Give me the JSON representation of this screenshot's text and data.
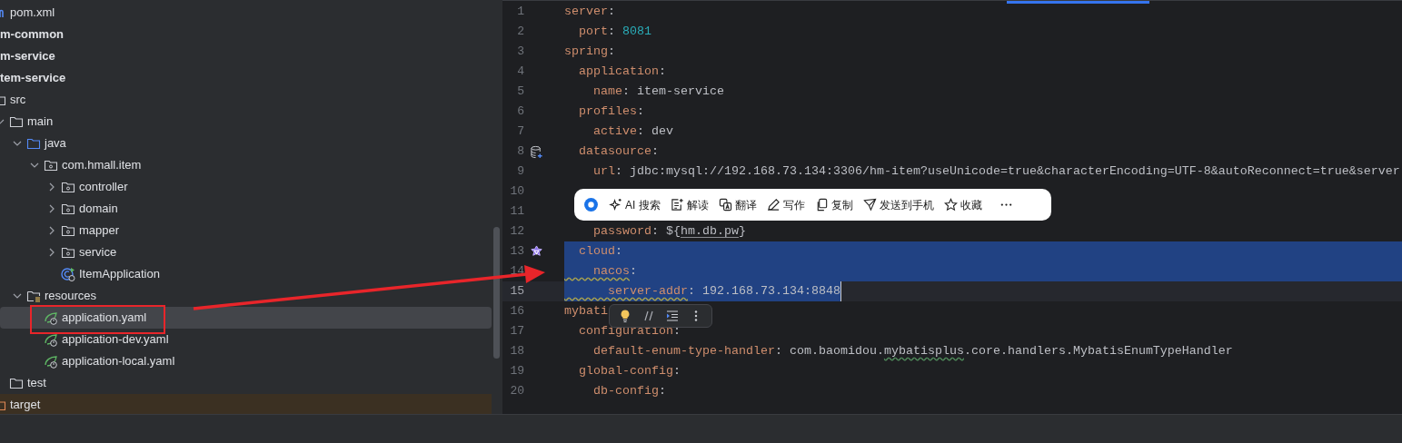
{
  "project_tree": [
    {
      "label": "pom.xml",
      "kind": "maven",
      "selected": false
    },
    {
      "label": "m-common",
      "kind": "module",
      "selected": false
    },
    {
      "label": "m-service",
      "kind": "module",
      "selected": false
    },
    {
      "label": "tem-service",
      "kind": "module",
      "selected": false,
      "children": [
        {
          "label": "src",
          "kind": "folder",
          "selected": false,
          "children": [
            {
              "label": "main",
              "kind": "folder",
              "expanded": true,
              "selected": false,
              "children": [
                {
                  "label": "java",
                  "kind": "source-folder",
                  "expanded": true,
                  "selected": false,
                  "children": [
                    {
                      "label": "com.hmall.item",
                      "kind": "package",
                      "expanded": true,
                      "selected": false,
                      "children": [
                        {
                          "label": "controller",
                          "kind": "package",
                          "expanded": false,
                          "selected": false
                        },
                        {
                          "label": "domain",
                          "kind": "package",
                          "expanded": false,
                          "selected": false
                        },
                        {
                          "label": "mapper",
                          "kind": "package",
                          "expanded": false,
                          "selected": false
                        },
                        {
                          "label": "service",
                          "kind": "package",
                          "expanded": false,
                          "selected": false
                        },
                        {
                          "label": "ItemApplication",
                          "kind": "spring-class",
                          "selected": false
                        }
                      ]
                    }
                  ]
                },
                {
                  "label": "resources",
                  "kind": "resource-folder",
                  "expanded": true,
                  "selected": false,
                  "children": [
                    {
                      "label": "application.yaml",
                      "kind": "spring-config",
                      "selected": true
                    },
                    {
                      "label": "application-dev.yaml",
                      "kind": "spring-config",
                      "selected": false
                    },
                    {
                      "label": "application-local.yaml",
                      "kind": "spring-config",
                      "selected": false
                    }
                  ]
                }
              ]
            },
            {
              "label": "test",
              "kind": "folder",
              "selected": false
            }
          ]
        },
        {
          "label": "target",
          "kind": "excluded-folder",
          "selected": false
        }
      ]
    }
  ],
  "editor": {
    "lines": [
      {
        "number": "1",
        "selected": false,
        "current": false,
        "tokens": [
          {
            "kind": "key",
            "text": "server"
          },
          {
            "kind": "text",
            "text": ":"
          }
        ]
      },
      {
        "number": "2",
        "selected": false,
        "current": false,
        "tokens": [
          {
            "kind": "key",
            "text": "  port"
          },
          {
            "kind": "text",
            "text": ": "
          },
          {
            "kind": "number",
            "text": "8081"
          }
        ]
      },
      {
        "number": "3",
        "selected": false,
        "current": false,
        "tokens": [
          {
            "kind": "key",
            "text": "spring"
          },
          {
            "kind": "text",
            "text": ":"
          }
        ]
      },
      {
        "number": "4",
        "selected": false,
        "current": false,
        "tokens": [
          {
            "kind": "key",
            "text": "  application"
          },
          {
            "kind": "text",
            "text": ":"
          }
        ]
      },
      {
        "number": "5",
        "selected": false,
        "current": false,
        "tokens": [
          {
            "kind": "key",
            "text": "    name"
          },
          {
            "kind": "text",
            "text": ": item-service"
          }
        ]
      },
      {
        "number": "6",
        "selected": false,
        "current": false,
        "tokens": [
          {
            "kind": "key",
            "text": "  profiles"
          },
          {
            "kind": "text",
            "text": ":"
          }
        ]
      },
      {
        "number": "7",
        "selected": false,
        "current": false,
        "tokens": [
          {
            "kind": "key",
            "text": "    active"
          },
          {
            "kind": "text",
            "text": ": dev"
          }
        ]
      },
      {
        "number": "8",
        "selected": false,
        "current": false,
        "kind": "database-marker",
        "tokens": [
          {
            "kind": "key",
            "text": "  datasource"
          },
          {
            "kind": "text",
            "text": ":"
          }
        ]
      },
      {
        "number": "9",
        "selected": false,
        "current": false,
        "tokens": [
          {
            "kind": "key",
            "text": "    url"
          },
          {
            "kind": "text",
            "text": ": jdbc:mysql://192.168.73.134:3306/hm-item?useUnicode=true&characterEncoding=UTF-8&autoReconnect=true&server"
          }
        ]
      },
      {
        "number": "10",
        "selected": false,
        "current": false
      },
      {
        "number": "11",
        "selected": false,
        "current": false
      },
      {
        "number": "12",
        "selected": false,
        "current": false,
        "tokens": [
          {
            "kind": "key",
            "text": "    password"
          },
          {
            "kind": "text",
            "text": ": ${"
          },
          {
            "kind": "ref",
            "text": "hm.db.pw"
          },
          {
            "kind": "text",
            "text": "}"
          }
        ]
      },
      {
        "number": "13",
        "selected": true,
        "current": false,
        "kind": "plugin-marker",
        "tokens": [
          {
            "kind": "key",
            "text": "  cloud"
          },
          {
            "kind": "text",
            "text": ":"
          }
        ]
      },
      {
        "number": "14",
        "selected": true,
        "current": false,
        "tokens": [
          {
            "kind": "key-typo",
            "text": "    nacos"
          },
          {
            "kind": "text",
            "text": ":"
          }
        ]
      },
      {
        "number": "15",
        "selected": true,
        "current": true,
        "tokens": [
          {
            "kind": "key-typo",
            "text": "      server-addr"
          },
          {
            "kind": "text",
            "text": ": 192.168.73.134:8848"
          }
        ]
      },
      {
        "number": "16",
        "selected": false,
        "current": false,
        "tokens": [
          {
            "kind": "key",
            "text": "mybati"
          }
        ]
      },
      {
        "number": "17",
        "selected": false,
        "current": false,
        "tokens": [
          {
            "kind": "key",
            "text": "  configuration"
          },
          {
            "kind": "text",
            "text": ":"
          }
        ]
      },
      {
        "number": "18",
        "selected": false,
        "current": false,
        "tokens": [
          {
            "kind": "key",
            "text": "    default-enum-type-handler"
          },
          {
            "kind": "text",
            "text": ": com.baomidou."
          },
          {
            "kind": "text-typo",
            "text": "mybatisplus"
          },
          {
            "kind": "text",
            "text": ".core.handlers.MybatisEnumTypeHandler"
          }
        ]
      },
      {
        "number": "19",
        "selected": false,
        "current": false,
        "tokens": [
          {
            "kind": "key",
            "text": "  global-config"
          },
          {
            "kind": "text",
            "text": ":"
          }
        ]
      },
      {
        "number": "20",
        "selected": false,
        "current": false,
        "tokens": [
          {
            "kind": "key",
            "text": "    db-config"
          },
          {
            "kind": "text",
            "text": ":"
          }
        ]
      }
    ]
  },
  "selection_toolbar": {
    "items": [
      {
        "label": "AI 搜索",
        "kind": "sparkle"
      },
      {
        "label": "解读",
        "kind": "note"
      },
      {
        "label": "翻译",
        "kind": "translate"
      },
      {
        "label": "写作",
        "kind": "pen"
      },
      {
        "label": "复制",
        "kind": "copy"
      },
      {
        "label": "发送到手机",
        "kind": "send"
      },
      {
        "label": "收藏",
        "kind": "star"
      }
    ]
  },
  "intention_toolbar": {
    "buttons": [
      {
        "kind": "bulb"
      },
      {
        "kind": "comment"
      },
      {
        "kind": "indent"
      },
      {
        "kind": "more"
      }
    ]
  }
}
